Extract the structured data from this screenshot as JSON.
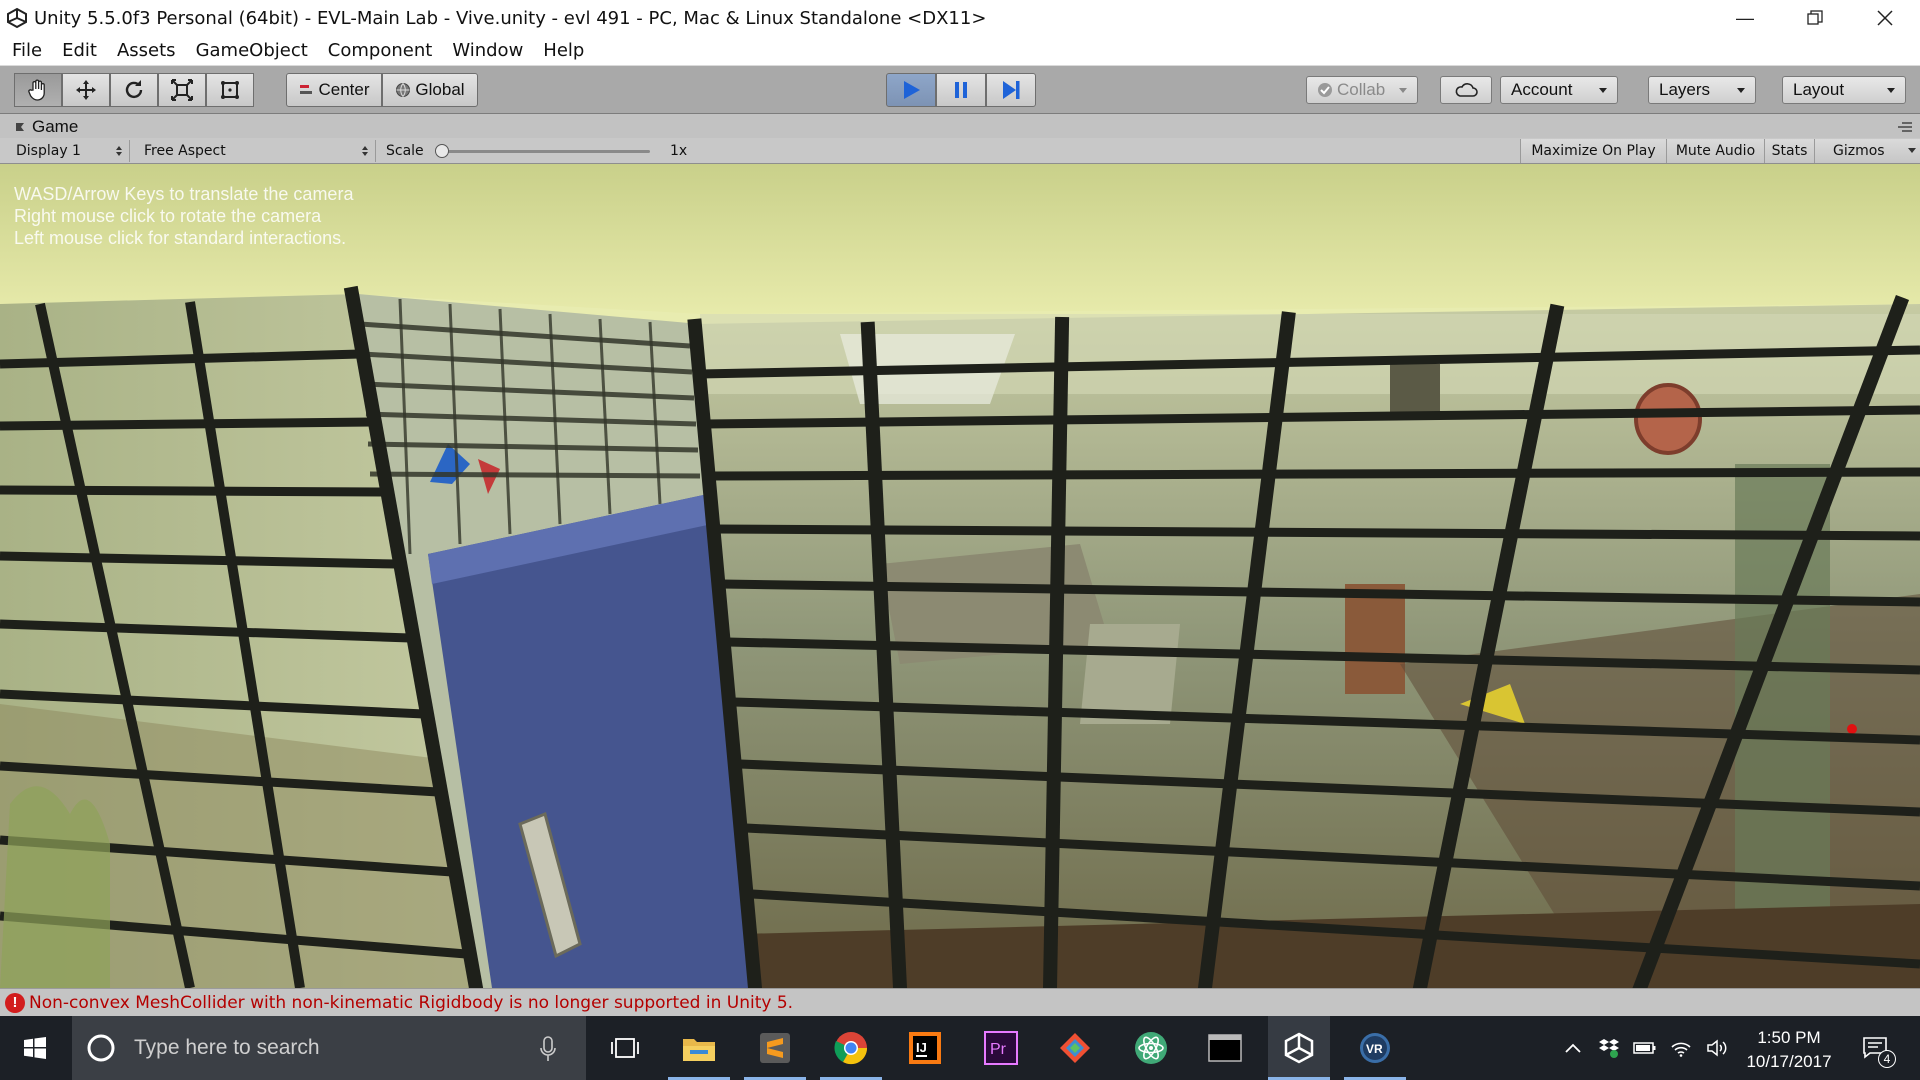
{
  "window": {
    "title": "Unity 5.5.0f3 Personal (64bit) - EVL-Main Lab - Vive.unity - evl 491 - PC, Mac & Linux Standalone <DX11>",
    "controls": [
      "minimize-icon",
      "restore-icon",
      "close-icon"
    ]
  },
  "menu": {
    "items": [
      "File",
      "Edit",
      "Assets",
      "GameObject",
      "Component",
      "Window",
      "Help"
    ]
  },
  "toolbar": {
    "transform_tools": [
      "hand-icon",
      "move-icon",
      "rotate-icon",
      "scale-icon",
      "rect-icon"
    ],
    "pivot_label": "Center",
    "space_label": "Global",
    "play_active": true,
    "collab_label": "Collab",
    "account_label": "Account",
    "layers_label": "Layers",
    "layout_label": "Layout"
  },
  "game_view": {
    "tab_label": "Game",
    "display_label": "Display 1",
    "aspect_label": "Free Aspect",
    "scale_label": "Scale",
    "scale_value": "1x",
    "maximize_label": "Maximize On Play",
    "mute_label": "Mute Audio",
    "stats_label": "Stats",
    "gizmos_label": "Gizmos",
    "hints": [
      "WASD/Arrow Keys to translate the camera",
      "Right mouse click to rotate the camera",
      "Left mouse click for standard interactions."
    ]
  },
  "status": {
    "message": "Non-convex MeshCollider with non-kinematic Rigidbody is no longer supported in Unity 5."
  },
  "taskbar": {
    "search_placeholder": "Type here to search",
    "time": "1:50 PM",
    "date": "10/17/2017",
    "notification_count": "4",
    "apps": [
      "task-view-icon",
      "file-explorer-icon",
      "sublime-text-icon",
      "chrome-icon",
      "intellij-icon",
      "premiere-icon",
      "git-icon",
      "atom-icon",
      "terminal-icon",
      "unity-icon",
      "vr-icon"
    ]
  },
  "colors": {
    "accent_blue": "#3a73d8",
    "error_red": "#b40000",
    "taskbar_bg": "#1c2026"
  }
}
